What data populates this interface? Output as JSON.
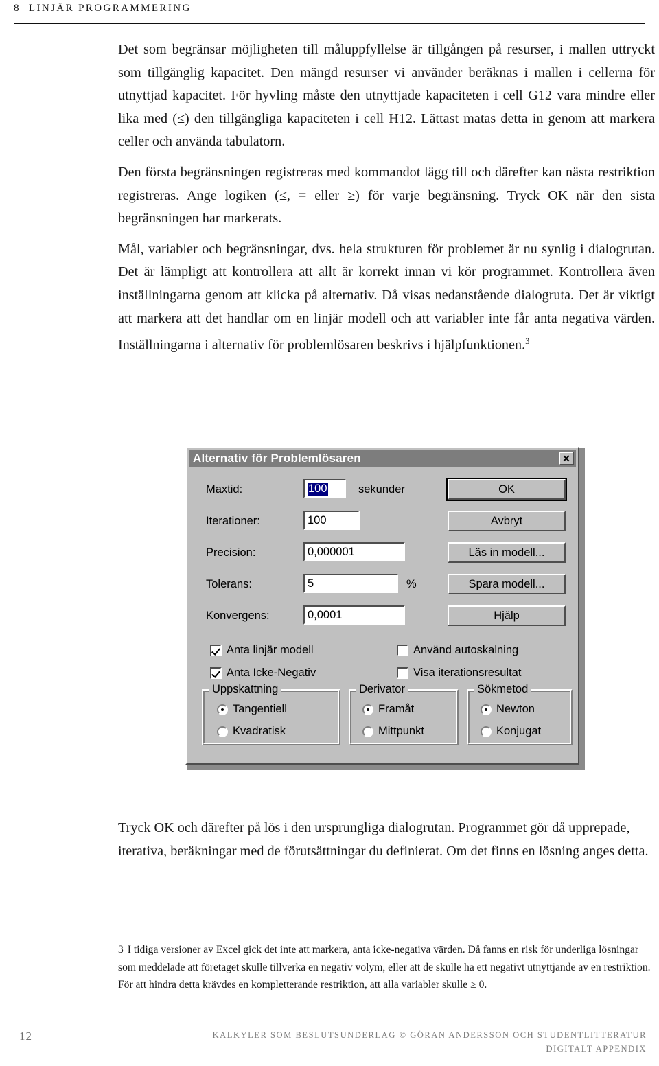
{
  "runhead": {
    "chapter_number": "8",
    "chapter_title": "LINJÄR PROGRAMMERING"
  },
  "body": {
    "p1": "Det som begränsar möjligheten till måluppfyllelse är tillgången på resurser, i mallen uttryckt som tillgänglig kapacitet. Den mängd resurser vi använder beräknas i mallen i cellerna för utnyttjad kapacitet. För hyvling måste den utnyttjade kapaciteten i cell G12 vara mindre eller lika med (≤) den tillgängliga kapaciteten i cell H12. Lättast matas detta in genom att markera celler och använda tabulatorn.",
    "p2": "Den första begränsningen registreras med kommandot lägg till och därefter kan nästa restriktion registreras. Ange logiken (≤, = eller ≥) för varje begränsning. Tryck OK när den sista begränsningen har markerats.",
    "p3_a": "Mål, variabler och begränsningar, dvs. hela strukturen för problemet är nu synlig i dialogrutan. Det är lämpligt att kontrollera att allt är korrekt innan vi kör programmet. Kontrollera även inställningarna genom att klicka på alternativ. Då visas nedanstående dialogruta. Det är viktigt att markera att det handlar om en linjär modell och att variabler inte får anta negativa värden. Inställningarna i alternativ för problemlösaren beskrivs i hjälpfunktionen.",
    "p3_footnote_marker": "3",
    "p4": "Tryck OK och därefter på lös i den ursprungliga dialogrutan. Programmet gör då upprepade, iterativa, beräkningar med de förutsättningar du definierat. Om det finns en lösning anges detta."
  },
  "footnote": {
    "number": "3",
    "text": "I tidiga versioner av Excel gick det inte att markera, anta icke-negativa värden. Då fanns en risk för underliga lösningar som meddelade att företaget skulle tillverka en negativ volym, eller att de skulle ha ett negativt utnyttjande av en restriktion. För att hindra detta krävdes en kompletterande restriktion, att alla variabler skulle ≥ 0."
  },
  "footer": {
    "page_number": "12",
    "colophon_line1": "KALKYLER SOM BESLUTSUNDERLAG © GÖRAN ANDERSSON OCH STUDENTLITTERATUR",
    "colophon_line2": "DIGITALT APPENDIX"
  },
  "dialog": {
    "title": "Alternativ för Problemlösaren",
    "close_glyph": "✕",
    "fields": [
      {
        "label": "Maxtid:",
        "value": "100",
        "suffix": "sekunder"
      },
      {
        "label": "Iterationer:",
        "value": "100",
        "suffix": ""
      },
      {
        "label": "Precision:",
        "value": "0,000001",
        "suffix": ""
      },
      {
        "label": "Tolerans:",
        "value": "5",
        "suffix": "%"
      },
      {
        "label": "Konvergens:",
        "value": "0,0001",
        "suffix": ""
      }
    ],
    "buttons": [
      {
        "label": "OK"
      },
      {
        "label": "Avbryt"
      },
      {
        "label": "Läs in modell..."
      },
      {
        "label": "Spara modell..."
      },
      {
        "label": "Hjälp"
      }
    ],
    "checkboxes": [
      {
        "label": "Anta linjär modell",
        "checked": true
      },
      {
        "label": "Använd autoskalning",
        "checked": false
      },
      {
        "label": "Anta Icke-Negativ",
        "checked": true
      },
      {
        "label": "Visa iterationsresultat",
        "checked": false
      }
    ],
    "groups": [
      {
        "title": "Uppskattning",
        "options": [
          {
            "label": "Tangentiell",
            "selected": true
          },
          {
            "label": "Kvadratisk",
            "selected": false
          }
        ]
      },
      {
        "title": "Derivator",
        "options": [
          {
            "label": "Framåt",
            "selected": true
          },
          {
            "label": "Mittpunkt",
            "selected": false
          }
        ]
      },
      {
        "title": "Sökmetod",
        "options": [
          {
            "label": "Newton",
            "selected": true
          },
          {
            "label": "Konjugat",
            "selected": false
          }
        ]
      }
    ]
  }
}
